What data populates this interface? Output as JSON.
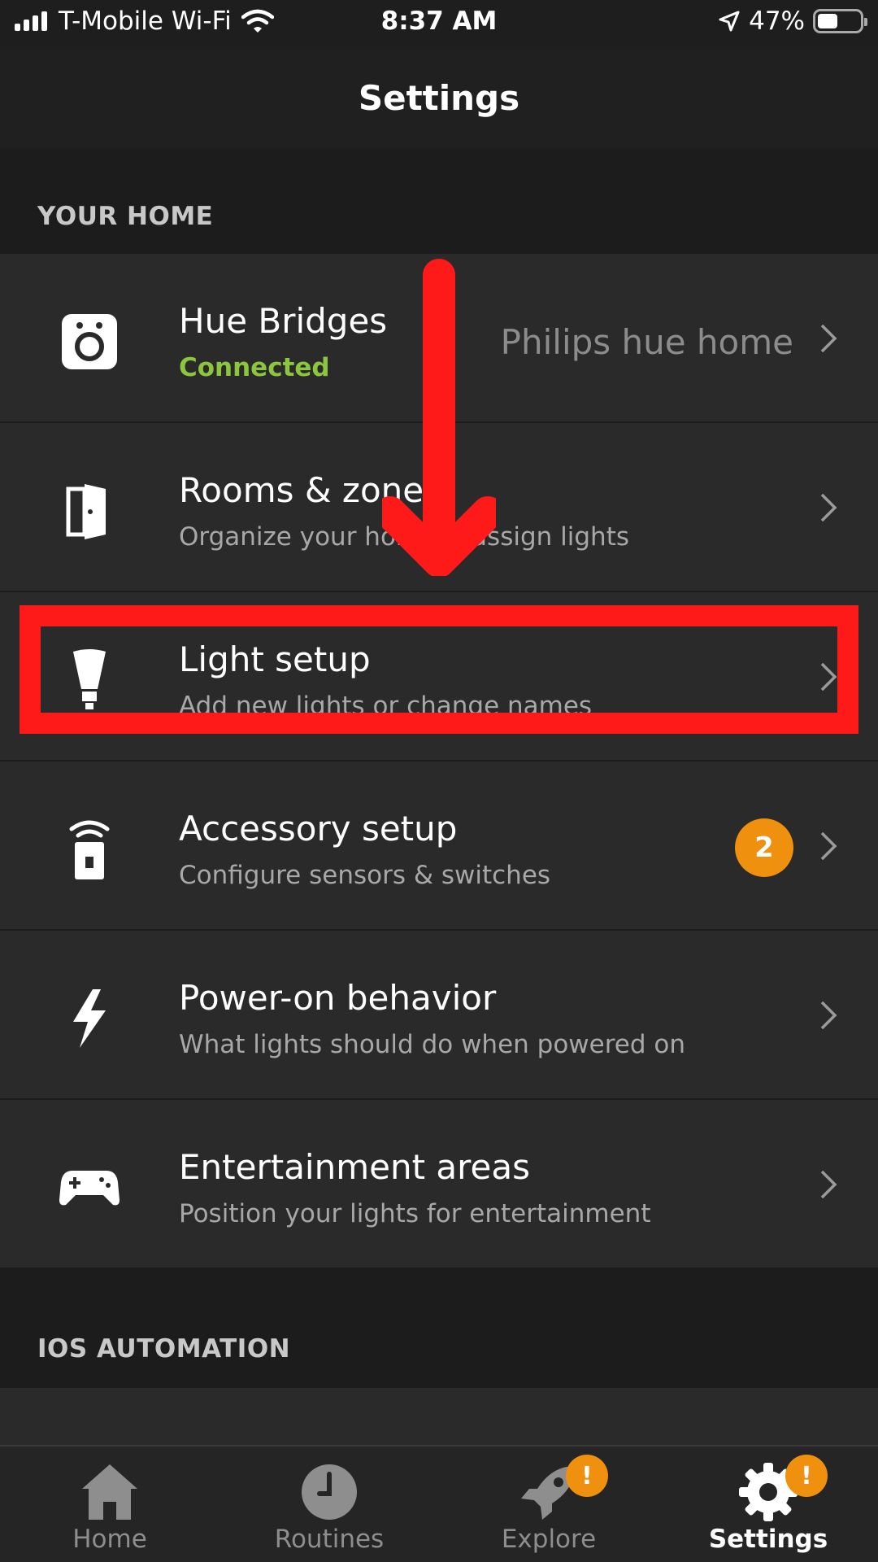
{
  "status_bar": {
    "carrier": "T-Mobile Wi-Fi",
    "time": "8:37 AM",
    "battery": "47%",
    "battery_level": 0.47
  },
  "nav": {
    "title": "Settings"
  },
  "sections": {
    "your_home": "YOUR HOME",
    "ios_automation": "IOS AUTOMATION"
  },
  "rows": [
    {
      "label": "Hue Bridges",
      "sub": "Connected",
      "value": "Philips hue home",
      "icon": "bridge-icon"
    },
    {
      "label": "Rooms & zones",
      "sub": "Organize your home & assign lights",
      "icon": "door-icon"
    },
    {
      "label": "Light setup",
      "sub": "Add new lights or change names",
      "icon": "bulb-icon"
    },
    {
      "label": "Accessory setup",
      "sub": "Configure sensors & switches",
      "badge": "2",
      "icon": "sensor-icon"
    },
    {
      "label": "Power-on behavior",
      "sub": "What lights should do when powered on",
      "icon": "lightning-icon"
    },
    {
      "label": "Entertainment areas",
      "sub": "Position your lights for entertainment",
      "icon": "gamepad-icon"
    }
  ],
  "tabs": [
    {
      "label": "Home",
      "icon": "home-icon"
    },
    {
      "label": "Routines",
      "icon": "clock-icon"
    },
    {
      "label": "Explore",
      "icon": "rocket-icon",
      "alert": "!"
    },
    {
      "label": "Settings",
      "icon": "gear-icon",
      "alert": "!"
    }
  ],
  "colors": {
    "accent_green": "#8cc63f",
    "badge_orange": "#f0900f",
    "annotation_red": "#ff1a1a"
  }
}
